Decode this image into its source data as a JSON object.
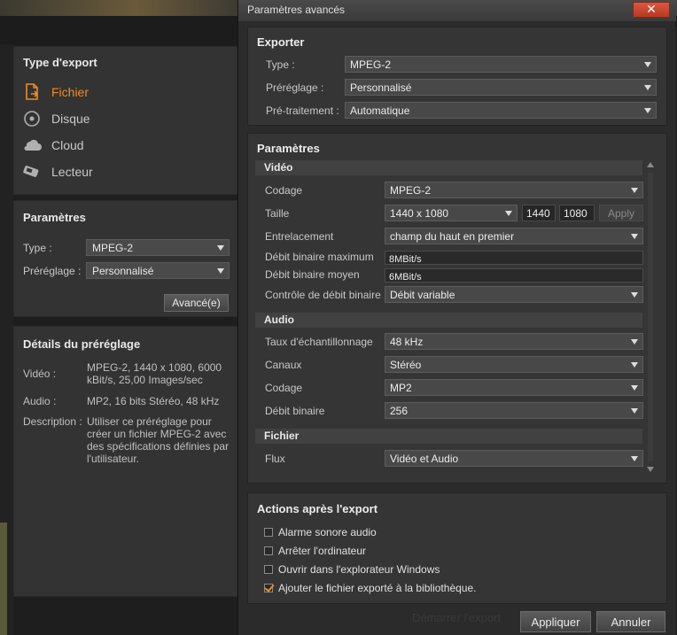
{
  "left": {
    "export_type": {
      "title": "Type d'export",
      "items": [
        {
          "label": "Fichier",
          "icon": "file-export-icon",
          "active": true
        },
        {
          "label": "Disque",
          "icon": "disc-icon",
          "active": false
        },
        {
          "label": "Cloud",
          "icon": "cloud-icon",
          "active": false
        },
        {
          "label": "Lecteur",
          "icon": "device-icon",
          "active": false
        }
      ]
    },
    "params": {
      "title": "Paramètres",
      "type_label": "Type :",
      "type_value": "MPEG-2",
      "preset_label": "Préréglage :",
      "preset_value": "Personnalisé",
      "advanced_button": "Avancé(e)"
    },
    "details": {
      "title": "Détails du préréglage",
      "video_label": "Vidéo :",
      "video_value": "MPEG-2, 1440 x 1080, 6000 kBit/s, 25,00 Images/sec",
      "audio_label": "Audio :",
      "audio_value": "MP2, 16 bits Stéréo, 48 kHz",
      "description_label": "Description :",
      "description_value": "Utiliser ce préréglage pour créer un fichier MPEG-2 avec des spécifications définies par l'utilisateur."
    },
    "start_export": "Démarrer l'export"
  },
  "dialog": {
    "title": "Paramètres avancés",
    "export": {
      "title": "Exporter",
      "type_label": "Type :",
      "type_value": "MPEG-2",
      "preset_label": "Préréglage :",
      "preset_value": "Personnalisé",
      "preprocess_label": "Pré-traitement :",
      "preprocess_value": "Automatique"
    },
    "params": {
      "title": "Paramètres",
      "video_header": "Vidéo",
      "codec_label": "Codage",
      "codec_value": "MPEG-2",
      "size_label": "Taille",
      "size_value": "1440 x 1080",
      "width_value": "1440",
      "height_value": "1080",
      "apply_label": "Apply",
      "interlace_label": "Entrelacement",
      "interlace_value": "champ du haut en premier",
      "max_bitrate_label": "Débit binaire maximum",
      "max_bitrate_value": "8MBit/s",
      "avg_bitrate_label": "Débit binaire moyen",
      "avg_bitrate_value": "6MBit/s",
      "bitrate_control_label": "Contrôle de débit binaire",
      "bitrate_control_value": "Débit variable",
      "audio_header": "Audio",
      "sample_rate_label": "Taux d'échantillonnage",
      "sample_rate_value": "48 kHz",
      "channels_label": "Canaux",
      "channels_value": "Stéréo",
      "audio_codec_label": "Codage",
      "audio_codec_value": "MP2",
      "audio_bitrate_label": "Débit binaire",
      "audio_bitrate_value": "256",
      "file_header": "Fichier",
      "stream_label": "Flux",
      "stream_value": "Vidéo et Audio"
    },
    "actions": {
      "title": "Actions après l'export",
      "items": [
        {
          "label": "Alarme sonore audio",
          "checked": false
        },
        {
          "label": "Arrêter l'ordinateur",
          "checked": false
        },
        {
          "label": "Ouvrir dans l'explorateur Windows",
          "checked": false
        },
        {
          "label": "Ajouter le fichier exporté à la bibliothèque.",
          "checked": true
        }
      ]
    },
    "apply_button": "Appliquer",
    "cancel_button": "Annuler"
  },
  "colors": {
    "accent": "#f08c1e",
    "close": "#c84a30"
  }
}
